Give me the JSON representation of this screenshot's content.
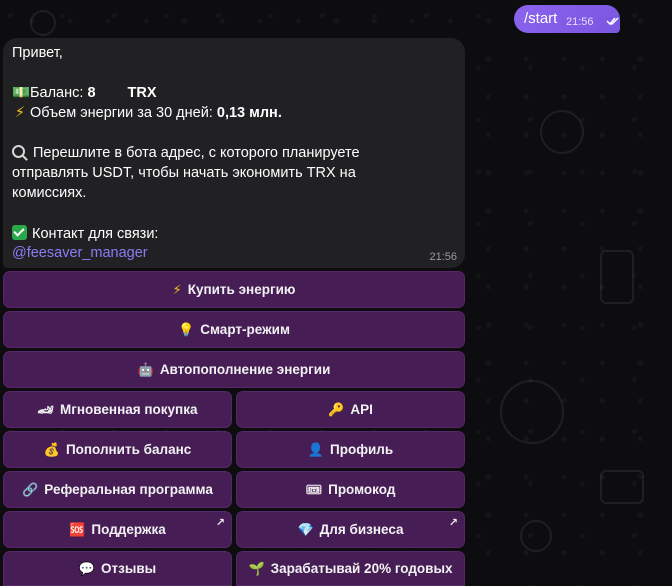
{
  "outgoing": {
    "text": "/start",
    "time": "21:56"
  },
  "incoming": {
    "greeting": "Привет,",
    "balance_label": "Баланс:",
    "balance_value": "8",
    "balance_currency": "TRX",
    "energy_label": "Объем энергии за 30 дней:",
    "energy_value": "0,13 млн.",
    "instruction_line1": "Перешлите в бота адрес, с которого планируете",
    "instruction_line2": "отправлять USDT, чтобы начать экономить TRX на",
    "instruction_line3": "комиссиях.",
    "contact_label": "Контакт для связи:",
    "contact_link": "@feesaver_manager",
    "time": "21:56"
  },
  "keyboard": {
    "buy_energy": "Купить энергию",
    "smart_mode": "Смарт-режим",
    "auto_refill": "Автопополнение энергии",
    "instant_buy": "Мгновенная покупка",
    "api": "API",
    "top_up": "Пополнить баланс",
    "profile": "Профиль",
    "referral": "Реферальная программа",
    "promo": "Промокод",
    "support": "Поддержка",
    "business": "Для бизнеса",
    "reviews": "Отзывы",
    "earn": "Зарабатывай 20% годовых"
  },
  "icons": {
    "money": "money-icon",
    "bolt": "lightning-icon",
    "search": "magnifier-icon",
    "check": "checkmark-icon",
    "bulb": "lightbulb-icon",
    "robot": "robot-icon",
    "car": "sports-car-icon",
    "key": "key-icon",
    "moneybag": "money-bag-icon",
    "person": "person-icon",
    "link": "link-icon",
    "ticket": "ticket-icon",
    "sos": "sos-icon",
    "gem": "gem-icon",
    "speech": "speech-bubble-icon",
    "seedling": "seedling-icon",
    "external": "external-link-arrow-icon"
  },
  "colors": {
    "outgoing_bubble": "#8b63ee",
    "incoming_bubble": "#212124",
    "button_bg": "#4c1e5c",
    "link": "#8b7cf6",
    "background": "#0d0d0f"
  }
}
